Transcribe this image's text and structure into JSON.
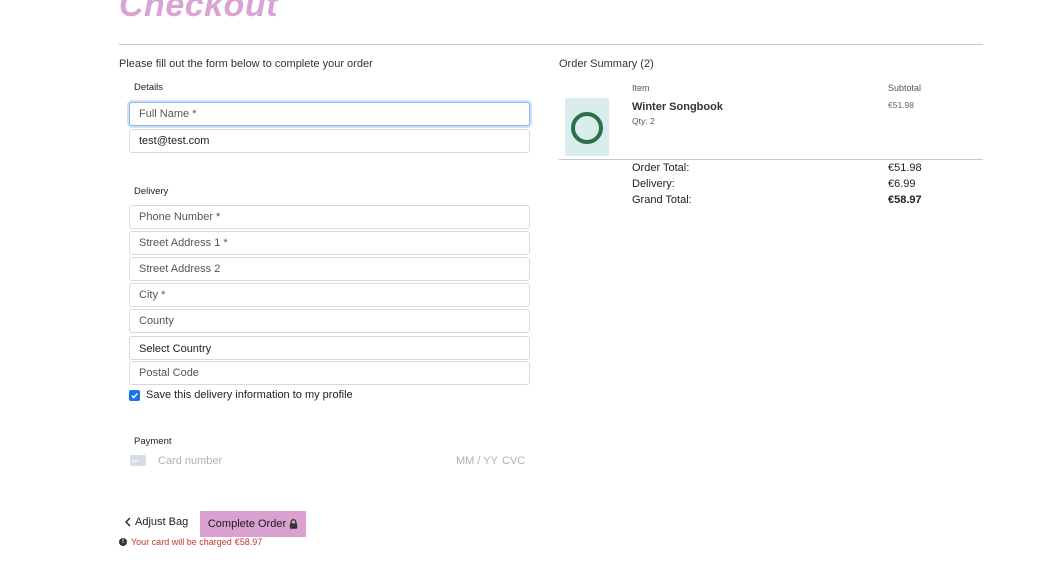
{
  "page": {
    "title": "Checkout",
    "intro": "Please fill out the form below to complete your order"
  },
  "details": {
    "label": "Details",
    "full_name_placeholder": "Full Name *",
    "email_value": "test@test.com"
  },
  "delivery": {
    "label": "Delivery",
    "phone_placeholder": "Phone Number *",
    "street1_placeholder": "Street Address 1 *",
    "street2_placeholder": "Street Address 2",
    "city_placeholder": "City *",
    "county_placeholder": "County",
    "country_selected": "Select Country",
    "postcode_placeholder": "Postal Code",
    "save_info_label": "Save this delivery information to my profile",
    "save_info_checked": true
  },
  "payment": {
    "label": "Payment",
    "card_placeholder": "Card number",
    "expiry_placeholder": "MM / YY",
    "cvc_placeholder": "CVC"
  },
  "actions": {
    "adjust_bag_label": "Adjust Bag",
    "complete_order_label": "Complete Order",
    "charge_prefix": "Your card will be charged ",
    "charge_amount": "€58.97"
  },
  "summary": {
    "title": "Order Summary (2)",
    "col_item": "Item",
    "col_subtotal": "Subtotal",
    "items": [
      {
        "name": "Winter Songbook",
        "qty": "Qty: 2",
        "subtotal": "€51.98"
      }
    ],
    "order_total_label": "Order Total:",
    "order_total_value": "€51.98",
    "delivery_label": "Delivery:",
    "delivery_value": "€6.99",
    "grand_total_label": "Grand Total:",
    "grand_total_value": "€58.97"
  },
  "colors": {
    "brand": "#d8a4d3",
    "button": "#d9a0d0",
    "error": "#c0392b",
    "checkbox": "#1a73e8"
  }
}
